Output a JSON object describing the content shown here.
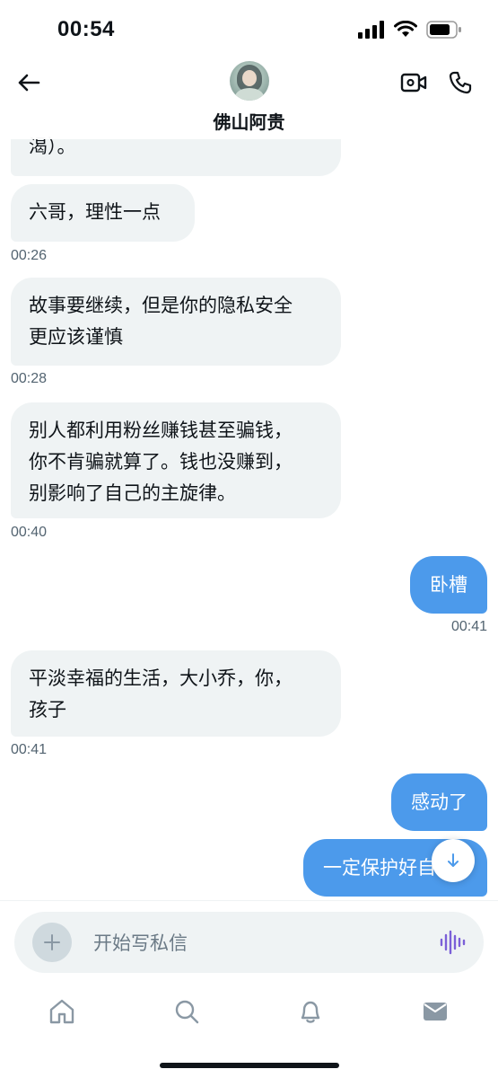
{
  "status_bar": {
    "time": "00:54"
  },
  "header": {
    "contact_name": "佛山阿贵"
  },
  "messages": [
    {
      "side": "in",
      "text": "渴）。",
      "time": ""
    },
    {
      "side": "in",
      "text": "六哥，理性一点",
      "time": "00:26"
    },
    {
      "side": "in",
      "lines": [
        "故事要继续，但是你的隐私安全",
        "更应该谨慎"
      ],
      "time": "00:28"
    },
    {
      "side": "in",
      "lines": [
        "别人都利用粉丝赚钱甚至骗钱，",
        "你不肯骗就算了。钱也没赚到，",
        "别影响了自己的主旋律。"
      ],
      "time": "00:40"
    },
    {
      "side": "out",
      "text": "卧槽",
      "time": "00:41"
    },
    {
      "side": "in",
      "lines": [
        "平淡幸福的生活，大小乔，你，",
        "孩子"
      ],
      "time": "00:41"
    },
    {
      "side": "out",
      "text": "感动了",
      "time": ""
    },
    {
      "side": "out",
      "text": "一定保护好自己",
      "time": ""
    }
  ],
  "composer": {
    "placeholder": "开始写私信"
  },
  "icons": {
    "back": "arrow-left-icon",
    "video": "video-camera-icon",
    "call": "phone-icon",
    "add": "plus-icon",
    "voice": "voice-wave-icon",
    "scroll": "arrow-down-icon",
    "tabs": [
      "home-icon",
      "search-icon",
      "bell-icon",
      "mail-icon"
    ]
  },
  "colors": {
    "outgoing_bubble": "#4c9aeb",
    "incoming_bubble": "#eff3f4",
    "voice_icon": "#7b5fd8"
  }
}
